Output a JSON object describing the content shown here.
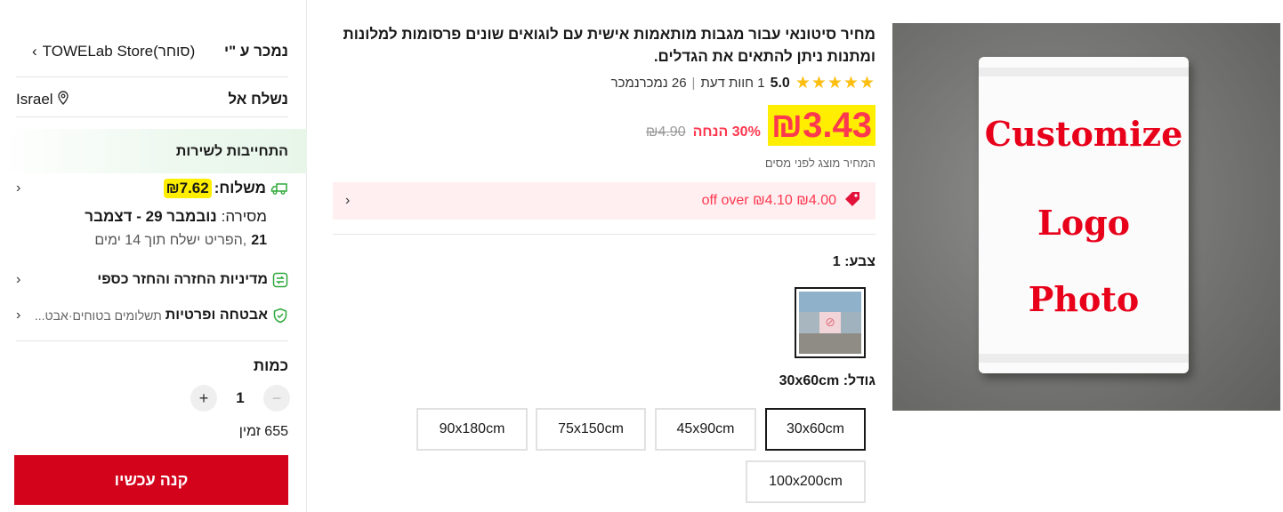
{
  "sidebar": {
    "sold_by_label": "נמכר ע \"י",
    "store_name": "TOWELab Store(סוחר)",
    "ship_to_label": "נשלח אל",
    "ship_to_value": "Israel",
    "service_commitment": "התחייבות לשירות",
    "shipping_label": "משלוח:",
    "shipping_cost": "₪7.62",
    "delivery_label": "מסירה:",
    "delivery_range": "נובמבר 29 - דצמבר",
    "delivery_day": "21",
    "ships_within": ",הפריט ישלח תוך 14 ימים",
    "return_policy": "מדיניות החזרה והחזר כספי",
    "security_label": "אבטחה ופרטיות",
    "security_detail": "תשלומים בטוחים·אבט...",
    "quantity_label": "כמות",
    "quantity_value": "1",
    "minus": "−",
    "plus": "+",
    "stock": "655 זמין",
    "buy_now": "קנה עכשיו"
  },
  "product": {
    "title": "מחיר סיטונאי עבור מגבות מותאמות אישית עם לוגואים שונים פרסומות למלונות ומתנות ניתן להתאים את הגדלים.",
    "rating_score": "5.0",
    "reviews": "1 חוות דעת",
    "sold": "26 נמכרנמכר",
    "price": "₪3.43",
    "discount": "30% הנחה",
    "old_price": "₪4.90",
    "tax_note": "המחיר מוצג לפני מסים",
    "coupon": "₪4.00 off over ₪4.10",
    "color_label": "צבע: 1",
    "size_label": "גודל: 30x60cm",
    "sizes": [
      "30x60cm",
      "45x90cm",
      "75x150cm",
      "90x180cm",
      "100x200cm"
    ],
    "selected_size": "30x60cm",
    "image_text": [
      "Customize",
      "Logo",
      "Photo"
    ]
  },
  "colors": {
    "accent_red": "#d3031c",
    "price_red": "#fd384f",
    "highlight_yellow": "#ffee00",
    "star_yellow": "#fdbe11",
    "green": "#2fa83b"
  },
  "icons": [
    "chevron-left-icon",
    "location-pin-icon",
    "truck-icon",
    "return-icon",
    "shield-check-icon",
    "star-icon",
    "coupon-tag-icon"
  ]
}
